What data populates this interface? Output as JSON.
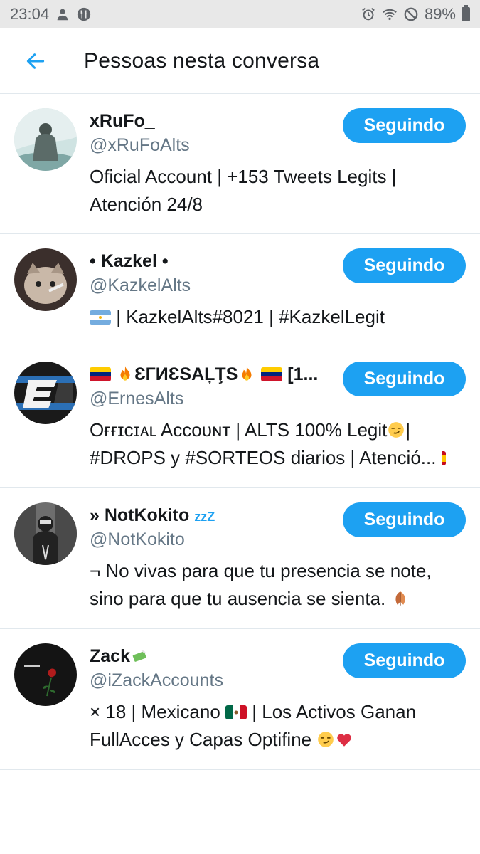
{
  "status_bar": {
    "time": "23:04",
    "battery": "89%"
  },
  "header": {
    "title": "Pessoas nesta conversa"
  },
  "colors": {
    "accent": "#1da1f2",
    "text": "#14171a",
    "secondary": "#657786",
    "divider": "#e1e8ed"
  },
  "people": [
    {
      "name": "xRuFo_",
      "handle": "@xRuFoAlts",
      "bio": [
        "Oficial Account | +153 Tweets Legits |",
        "Atención 24/8"
      ],
      "button": "Seguindo"
    },
    {
      "name": "• Kazkel •",
      "handle": "@KazkelAlts",
      "bio_text": "| KazkelAlts#8021 | #KazkelLegit",
      "button": "Seguindo"
    },
    {
      "name_text": "ƐГИƐSAĻŢS",
      "name_suffix": "[1...",
      "handle": "@ErnesAlts",
      "bio_line1": "Oғғɪᴄɪᴀʟ Aᴄᴄᴏᴜɴᴛ | ALTS 100% Legit",
      "bio_line1_end": "|",
      "bio_line2": "#DROPS y #SORTEOS diarios | Atenció...",
      "button": "Seguindo"
    },
    {
      "name": "» NotKokito",
      "name_zzz": "zzZ",
      "handle": "@NotKokito",
      "bio": [
        "¬ No vivas para que tu presencia se note,",
        "sino para que tu ausencia se sienta."
      ],
      "button": "Seguindo"
    },
    {
      "name": "Zack",
      "handle": "@iZackAccounts",
      "bio_line1a": "× 18 | Mexicano",
      "bio_line1b": "| Los Activos Ganan",
      "bio_line2": "FullAcces y Capas Optifine",
      "button": "Seguindo"
    }
  ]
}
